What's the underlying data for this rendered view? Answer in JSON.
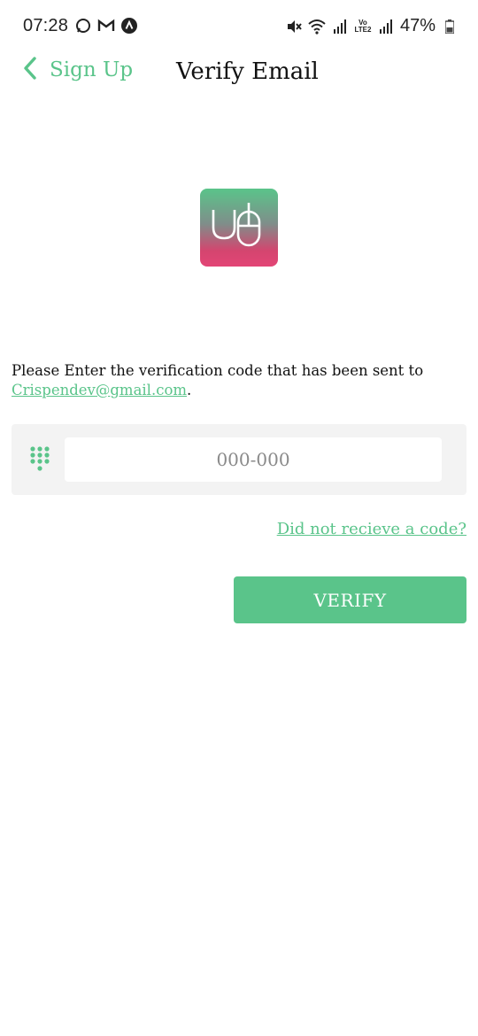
{
  "status_bar": {
    "time": "07:28",
    "left_icons": [
      "whatsapp-icon",
      "gmail-icon",
      "app-icon"
    ],
    "right_icons": [
      "mute-icon",
      "wifi-icon",
      "signal-icon",
      "lte-icon",
      "signal-icon",
      "battery-icon"
    ],
    "lte_label": "Vo LTE2",
    "battery": "47%"
  },
  "header": {
    "back_label": "Sign Up",
    "title": "Verify Email"
  },
  "logo": {
    "icon": "app-logo-icon",
    "colors": {
      "top": "#5ac48a",
      "bottom": "#e34576"
    }
  },
  "instruction": {
    "text": "Please Enter the verification code that has been sent to ",
    "email": "Crispendev@gmail.com",
    "suffix": "."
  },
  "code_field": {
    "icon": "dialpad-icon",
    "placeholder": "000-000",
    "value": ""
  },
  "resend_link": "Did not recieve a code?",
  "verify_button": "VERIFY",
  "colors": {
    "accent": "#5ac48a",
    "field_bg": "#f3f3f3"
  }
}
